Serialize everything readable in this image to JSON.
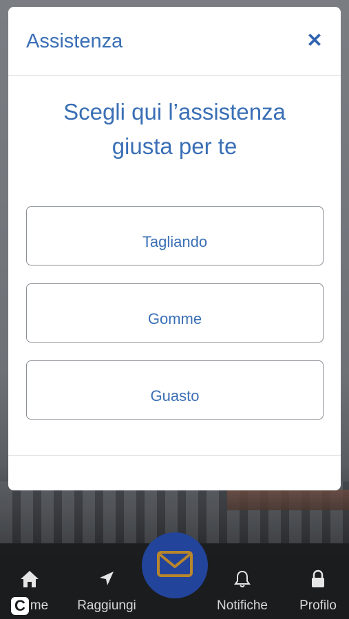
{
  "modal": {
    "title": "Assistenza",
    "close_symbol": "✕",
    "heading_line1": "Scegli qui l’assistenza",
    "heading_line2": "giusta per te",
    "options": [
      {
        "label": "Tagliando"
      },
      {
        "label": "Gomme"
      },
      {
        "label": "Guasto"
      }
    ]
  },
  "tabbar": {
    "tabs": [
      {
        "label": "me",
        "icon": "home-icon"
      },
      {
        "label": "Raggiungi",
        "icon": "navigation-arrow-icon"
      },
      {
        "label": "Notifiche",
        "icon": "bell-icon"
      },
      {
        "label": "Profilo",
        "icon": "lock-icon"
      }
    ],
    "center_icon": "mail-icon",
    "badge_letter": "C"
  },
  "colors": {
    "accent": "#3a6fb5",
    "fab": "#22449a",
    "envelope": "#b8862c",
    "tabbar": "#1b1c1e"
  }
}
